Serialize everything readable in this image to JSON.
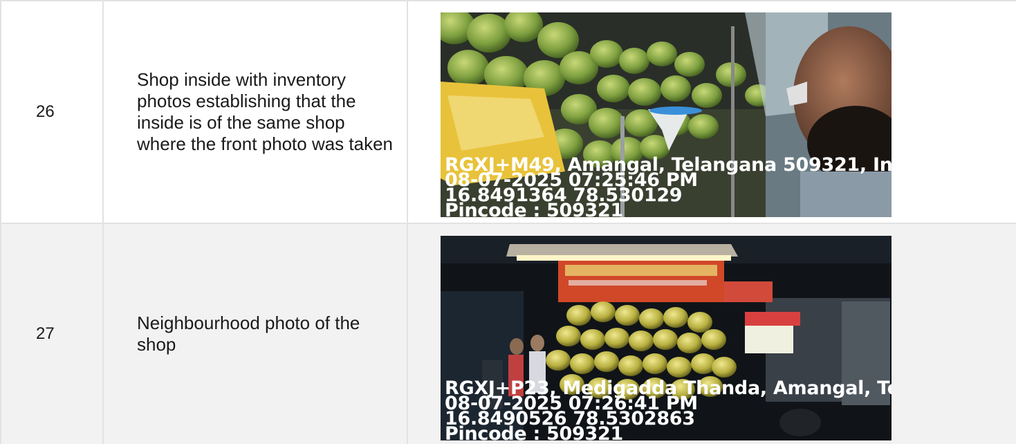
{
  "rows": [
    {
      "number": "26",
      "description": "Shop inside with inventory photos establishing that the inside is of the same shop where the front photo was taken",
      "photo": {
        "subject": "coconut-stall-inside-photo",
        "stamp": {
          "address": "RGXJ+M49, Amangal, Telangana 509321, In",
          "datetime": "08-07-2025 07:25:46 PM",
          "coords": "16.8491364 78.530129",
          "pincode": "Pincode : 509321"
        }
      }
    },
    {
      "number": "27",
      "description": "Neighbourhood photo of the shop",
      "photo": {
        "subject": "coconut-stall-night-photo",
        "stamp": {
          "address": "RGXJ+P23, Medigadda Thanda, Amangal, Te",
          "datetime": "08-07-2025 07:26:41 PM",
          "coords": "16.8490526 78.5302863",
          "pincode": "Pincode : 509321"
        }
      }
    }
  ]
}
